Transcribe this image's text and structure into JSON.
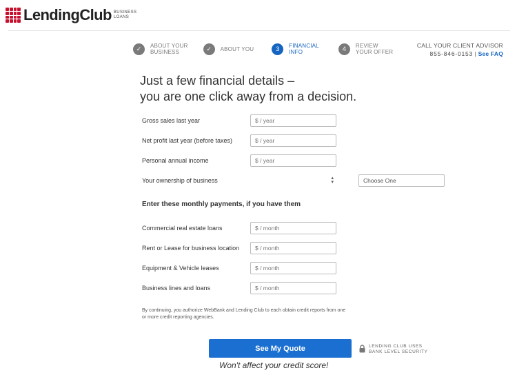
{
  "brand": {
    "name": "LendingClub",
    "sub_line1": "BUSINESS",
    "sub_line2": "LOANS",
    "color": "#c8102e"
  },
  "steps": [
    {
      "number": "✓",
      "line1": "ABOUT YOUR",
      "line2": "BUSINESS",
      "state": "done"
    },
    {
      "number": "✓",
      "line1": "ABOUT YOU",
      "line2": "",
      "state": "done"
    },
    {
      "number": "3",
      "line1": "FINANCIAL",
      "line2": "INFO",
      "state": "active"
    },
    {
      "number": "4",
      "line1": "REVIEW",
      "line2": "YOUR OFFER",
      "state": "pending"
    }
  ],
  "advisor": {
    "title": "CALL YOUR CLIENT ADVISOR",
    "phone": "855-846-0153",
    "separator": "|",
    "faq": "See FAQ"
  },
  "headline": {
    "line1": "Just a few financial details –",
    "line2": "you are one click away from a decision."
  },
  "annual_fields": [
    {
      "label": "Gross sales last year",
      "placeholder": "$ / year"
    },
    {
      "label": "Net profit last year (before taxes)",
      "placeholder": "$ / year"
    },
    {
      "label": "Personal annual income",
      "placeholder": "$ / year"
    }
  ],
  "ownership": {
    "label": "Your ownership of business",
    "selected": "Choose One"
  },
  "monthly_heading": "Enter these monthly payments, if you have them",
  "monthly_fields": [
    {
      "label": "Commercial real estate loans",
      "placeholder": "$ / month"
    },
    {
      "label": "Rent or Lease for business location",
      "placeholder": "$ / month"
    },
    {
      "label": "Equipment & Vehicle leases",
      "placeholder": "$ / month"
    },
    {
      "label": "Business lines and loans",
      "placeholder": "$ / month"
    }
  ],
  "disclaimer": "By continuing, you authorize WebBank and Lending Club to each obtain credit reports from one or more credit reporting agencies.",
  "cta": {
    "label": "See My Quote",
    "color": "#1a6fd1"
  },
  "security": {
    "line1": "LENDING CLUB USES",
    "line2": "BANK LEVEL SECURITY"
  },
  "credit_note": "Won't affect your credit score!",
  "accent": "#1565c0"
}
